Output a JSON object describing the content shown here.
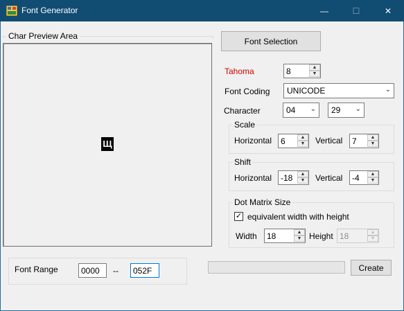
{
  "window": {
    "title": "Font Generator",
    "minimize_glyph": "—",
    "maximize_glyph": "☐",
    "close_glyph": "✕"
  },
  "preview": {
    "legend": "Char Preview Area",
    "glyph": "Щ"
  },
  "font_selection_button": "Font Selection",
  "font": {
    "name": "Tahoma",
    "size": "8",
    "name_color": "#d40000"
  },
  "font_coding": {
    "label": "Font Coding",
    "value": "UNICODE"
  },
  "character": {
    "label": "Character",
    "high": "04",
    "low": "29"
  },
  "scale": {
    "legend": "Scale",
    "horizontal_label": "Horizontal",
    "horizontal": "6",
    "vertical_label": "Vertical",
    "vertical": "7"
  },
  "shift": {
    "legend": "Shift",
    "horizontal_label": "Horizontal",
    "horizontal": "-18",
    "vertical_label": "Vertical",
    "vertical": "-4"
  },
  "dot_matrix": {
    "legend": "Dot Matrix Size",
    "equivalent_label": "equivalent width with height",
    "equivalent_checked": true,
    "width_label": "Width",
    "width": "18",
    "height_label": "Height",
    "height": "18"
  },
  "font_range": {
    "label": "Font Range",
    "from": "0000",
    "separator": "--",
    "to": "052F"
  },
  "progress": {
    "value": 0
  },
  "create_button": "Create",
  "icons": {
    "spin_up": "▲",
    "spin_down": "▼",
    "dropdown": "⌄",
    "check": "✓"
  }
}
